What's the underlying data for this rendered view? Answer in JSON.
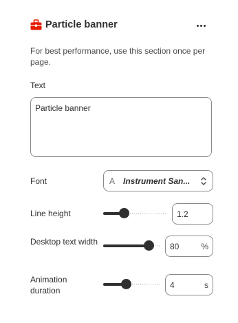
{
  "header": {
    "title": "Particle banner",
    "icon": "toolbox-icon",
    "icon_color": "#e51c00",
    "more": "more-horizontal-icon"
  },
  "info": "For best performance, use this section once per page.",
  "text_field": {
    "label": "Text",
    "value": "Particle banner"
  },
  "font": {
    "label": "Font",
    "glyph": "A",
    "value": "Instrument San...",
    "icon": "chevron-up-down-icon"
  },
  "line_height": {
    "label": "Line height",
    "value": "1.2",
    "level": 0.32
  },
  "desktop_text_width": {
    "label": "Desktop text width",
    "value": "80",
    "unit": "%",
    "level": 0.8
  },
  "animation_duration": {
    "label": "Animation duration",
    "value": "4",
    "unit": "s",
    "level": 0.4
  }
}
